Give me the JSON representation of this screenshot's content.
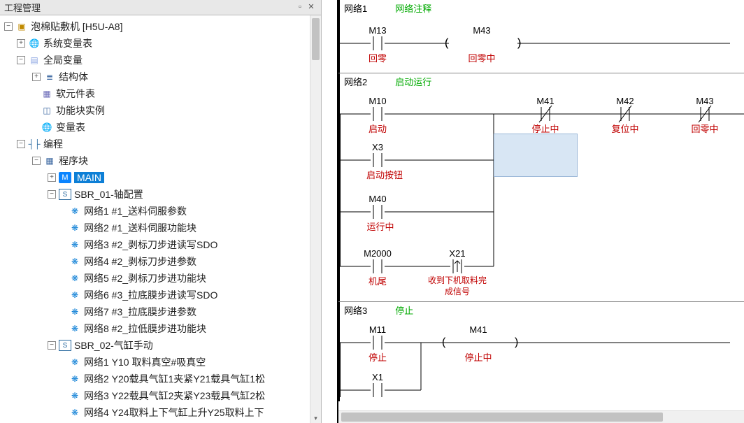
{
  "panel_title": "工程管理",
  "tree": {
    "root": {
      "label": "泡棉贴敷机 [H5U-A8]"
    },
    "sys_var": "系统变量表",
    "global": "全局变量",
    "struct": "结构体",
    "sfc": "软元件表",
    "fnblk": "功能块实例",
    "vartab": "变量表",
    "prog": "编程",
    "pblk": "程序块",
    "main": "MAIN",
    "sbr01": "SBR_01-轴配置",
    "sbr01_items": [
      "网络1 #1_送料伺服参数",
      "网络2 #1_送料伺服功能块",
      "网络3 #2_剥标刀步进读写SDO",
      "网络4 #2_剥标刀步进参数",
      "网络5 #2_剥标刀步进功能块",
      "网络6 #3_拉底膜步进读写SDO",
      "网络7 #3_拉底膜步进参数",
      "网络8 #2_拉低膜步进功能块"
    ],
    "sbr02": "SBR_02-气缸手动",
    "sbr02_items": [
      "网络1 Y10 取料真空#吸真空",
      "网络2 Y20载具气缸1夹紧Y21载具气缸1松",
      "网络3 Y22载具气缸2夹紧Y23载具气缸2松",
      "网络4 Y24取料上下气缸上升Y25取料上下"
    ]
  },
  "networks": {
    "n1": {
      "name": "网络1",
      "title": "网络注释"
    },
    "n2": {
      "name": "网络2",
      "title": "启动运行"
    },
    "n3": {
      "name": "网络3",
      "title": "停止"
    }
  },
  "elems": {
    "m13": {
      "a": "M13",
      "d": "回零"
    },
    "m43": {
      "a": "M43",
      "d": "回零中"
    },
    "m10": {
      "a": "M10",
      "d": "启动"
    },
    "m41": {
      "a": "M41",
      "d": "停止中"
    },
    "m42": {
      "a": "M42",
      "d": "复位中"
    },
    "m43b": {
      "a": "M43",
      "d": "回零中"
    },
    "x3": {
      "a": "X3",
      "d": "启动按钮"
    },
    "m40": {
      "a": "M40",
      "d": "运行中"
    },
    "m2000": {
      "a": "M2000",
      "d": "机尾"
    },
    "x21": {
      "a": "X21",
      "d1": "收到下机取料完",
      "d2": "成信号"
    },
    "m11": {
      "a": "M11",
      "d": "停止"
    },
    "m41b": {
      "a": "M41",
      "d": "停止中"
    },
    "x1": {
      "a": "X1"
    }
  }
}
